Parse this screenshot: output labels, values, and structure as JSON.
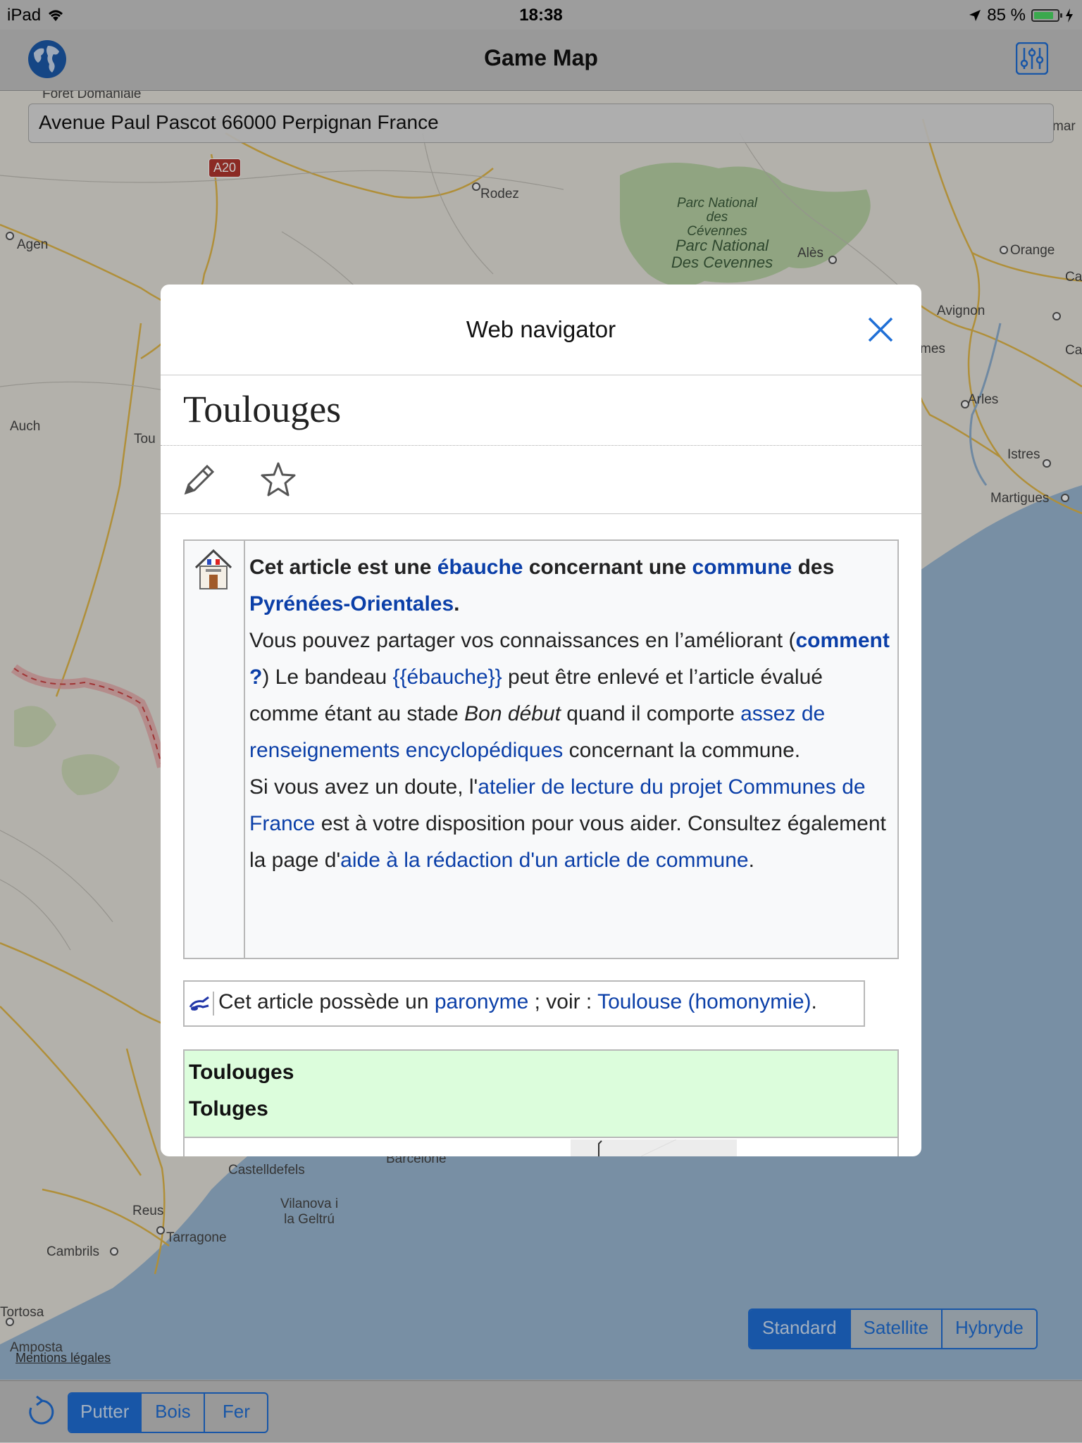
{
  "status_bar": {
    "device": "iPad",
    "time": "18:38",
    "battery": "85 %",
    "battery_level": 0.85
  },
  "nav": {
    "title": "Game Map",
    "left_icon": "globe-icon",
    "right_icon": "sliders-icon"
  },
  "map": {
    "address": "Avenue Paul Pascot 66000 Perpignan France",
    "road_sign": "A20",
    "labels": {
      "foret": "Forêt Domaniale",
      "rodez": "Rodez",
      "agen": "Agen",
      "auch": "Auch",
      "toulouse": "Tou",
      "parc_small": "Parc National\ndes Cévennes",
      "parc_big": "Parc National\nDes Cevennes",
      "ales": "Alès",
      "orange": "Orange",
      "avignon": "Avignon",
      "nimes": "mes",
      "arles": "Arles",
      "istres": "Istres",
      "martigues": "Martigues",
      "castelldefels": "Castelldefels",
      "barcelone": "Barcelone",
      "vilanova": "Vilanova i\nla Geltrú",
      "reus": "Reus",
      "tarragone": "Tarragone",
      "cambrils": "Cambrils",
      "tortosa": "Tortosa",
      "amposta": "Amposta",
      "mar": "mar",
      "ca": "Ca"
    },
    "map_types": [
      "Standard",
      "Satellite",
      "Hybryde"
    ],
    "selected_map_type": "Standard",
    "legal": "Mentions légales"
  },
  "toolbar": {
    "refresh_icon": "refresh-icon",
    "clubs": [
      "Putter",
      "Bois",
      "Fer"
    ],
    "selected_club": "Putter"
  },
  "modal": {
    "title": "Web navigator",
    "close_icon": "close-icon",
    "article_title": "Toulouges",
    "edit_icon": "pencil-icon",
    "watch_icon": "star-icon",
    "stub": {
      "icon": "town-hall-icon",
      "s1a": "Cet article est une ",
      "s1_link1": "ébauche",
      "s1b": " concernant une ",
      "s1_link2": "commune",
      "s1c": " des ",
      "s1_link3": "Pyrénées-Orientales",
      "s1d": ".",
      "s2a": "Vous pouvez partager vos connaissances en l’améliorant (",
      "s2_link1": "comment ?",
      "s2b": ") Le bandeau ",
      "s2_link2": "{{ébauche}}",
      "s2c": " peut être enlevé et l’article évalué comme étant au stade ",
      "s2_italic": "Bon début",
      "s2d": " quand il comporte ",
      "s2_link3": "assez de renseignements encyclopédiques",
      "s2e": " concernant la commune.",
      "s3a": "Si vous avez un doute, l'",
      "s3_link1": "atelier de lecture du projet Communes de France",
      "s3b": " est à votre disposition pour vous aider. Consultez également la page d'",
      "s3_link2": "aide à la rédaction d'un article de commune",
      "s3c": "."
    },
    "paronym": {
      "icon": "paronym-icon",
      "a": "Cet article possède un ",
      "link1": "paronyme",
      "b": " ; voir : ",
      "link2": "Toulouse (homonymie)",
      "c": "."
    },
    "infobox": {
      "name1": "Toulouges",
      "name2": "Toluges",
      "header_color": "#dcfddc"
    }
  },
  "colors": {
    "accent": "#1f6fd6",
    "link": "#0b3fa8",
    "water": "#9ab8d3",
    "land": "#e6e3dc"
  }
}
